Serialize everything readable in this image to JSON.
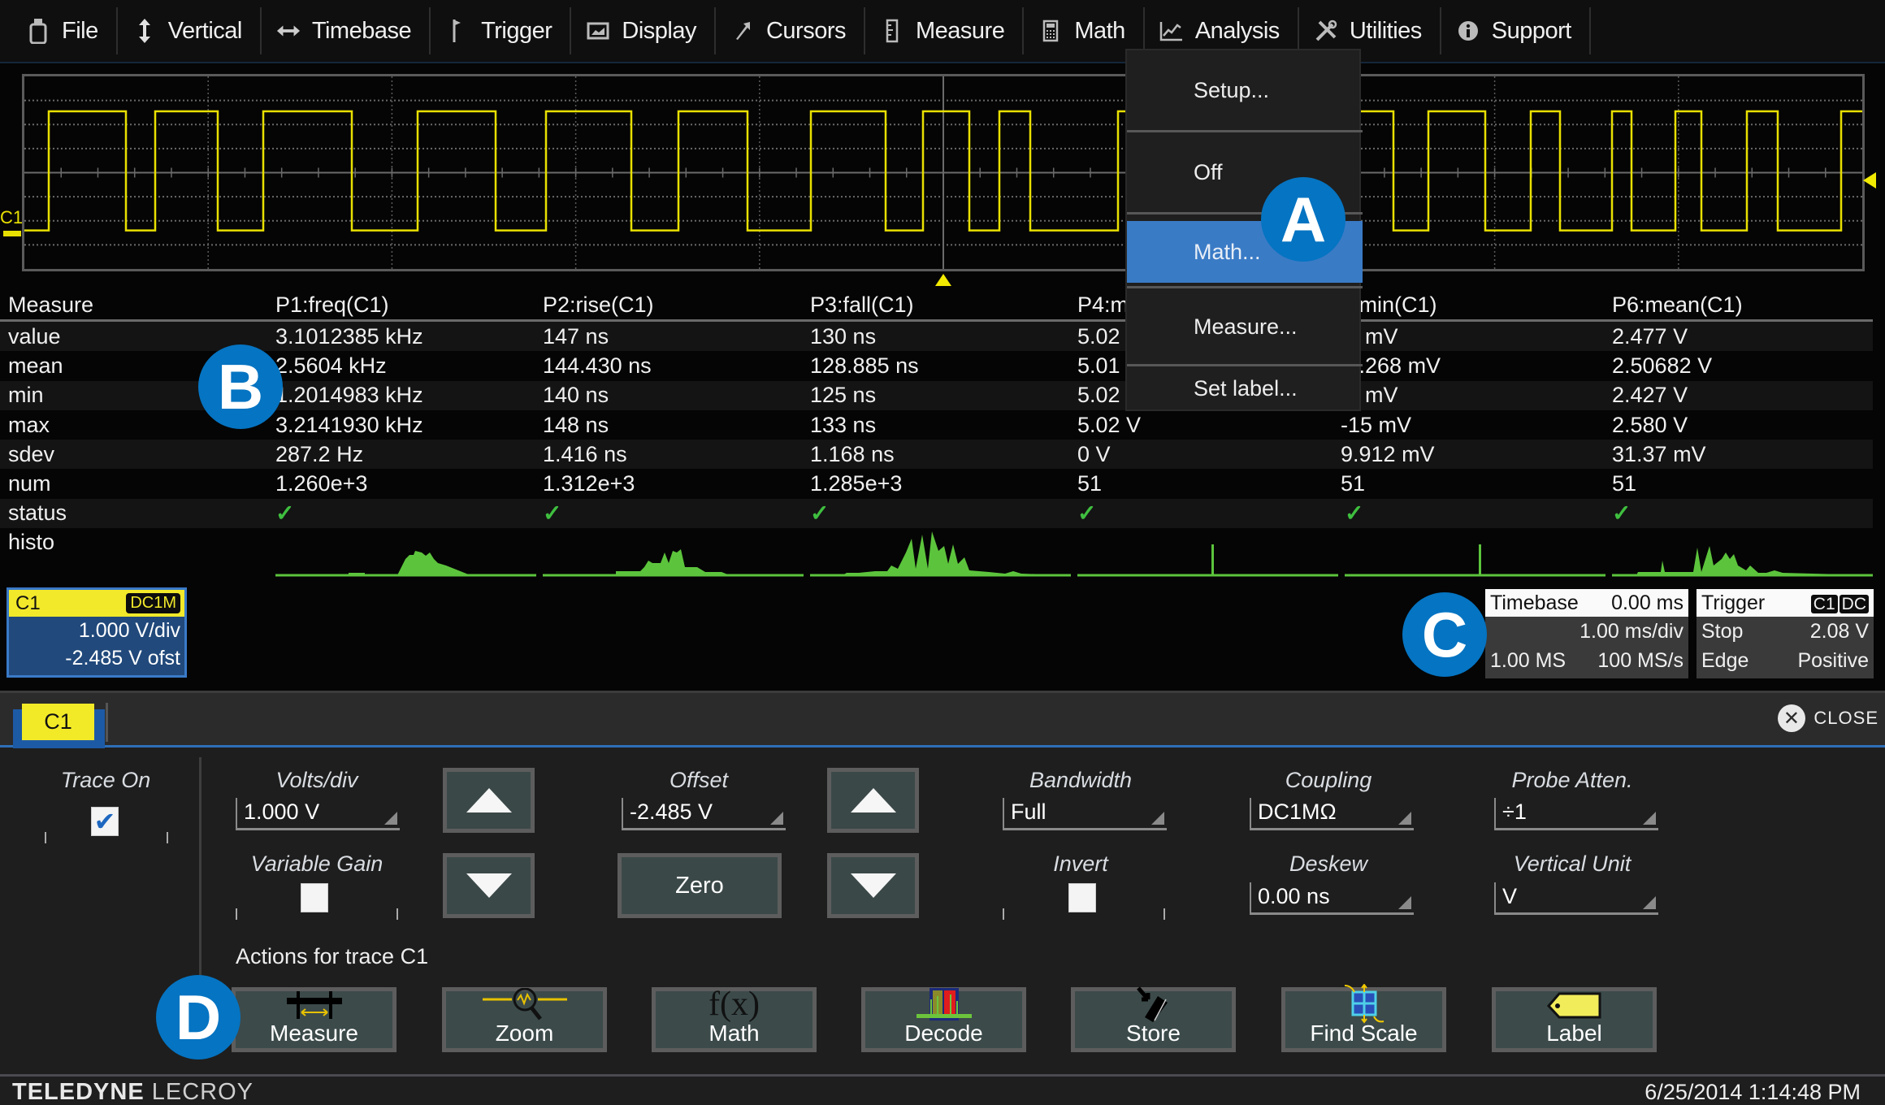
{
  "menubar": {
    "items": [
      {
        "label": "File",
        "icon": "file-icon"
      },
      {
        "label": "Vertical",
        "icon": "vertical-arrows-icon"
      },
      {
        "label": "Timebase",
        "icon": "horizontal-arrows-icon"
      },
      {
        "label": "Trigger",
        "icon": "trigger-flag-icon"
      },
      {
        "label": "Display",
        "icon": "display-icon"
      },
      {
        "label": "Cursors",
        "icon": "cursor-arrow-icon"
      },
      {
        "label": "Measure",
        "icon": "measure-ruler-icon"
      },
      {
        "label": "Math",
        "icon": "calculator-icon"
      },
      {
        "label": "Analysis",
        "icon": "chart-icon"
      },
      {
        "label": "Utilities",
        "icon": "tools-icon"
      },
      {
        "label": "Support",
        "icon": "info-icon"
      }
    ]
  },
  "dropdown": {
    "items": [
      {
        "label": "Setup...",
        "selected": false
      },
      {
        "label": "Off",
        "selected": false
      },
      {
        "label": "Math...",
        "selected": true
      },
      {
        "label": "Measure...",
        "selected": false
      },
      {
        "label": "Set label...",
        "selected": false
      }
    ]
  },
  "waveform": {
    "channel_label": "C1",
    "trace_color": "#e8e000"
  },
  "measurements": {
    "header": [
      "Measure",
      "P1:freq(C1)",
      "P2:rise(C1)",
      "P3:fall(C1)",
      "P4:m",
      "5:min(C1)",
      "P6:mean(C1)"
    ],
    "rows": [
      {
        "label": "value",
        "cells": [
          "3.1012385 kHz",
          "147 ns",
          "130 ns",
          "5.02",
          ".5 mV",
          "2.477 V"
        ]
      },
      {
        "label": "mean",
        "cells": [
          "2.5604 kHz",
          "144.430 ns",
          "128.885 ns",
          "5.01",
          ".8.268 mV",
          "2.50682 V"
        ]
      },
      {
        "label": "min",
        "cells": [
          "1.2014983 kHz",
          "140 ns",
          "125 ns",
          "5.02",
          ".8 mV",
          "2.427 V"
        ]
      },
      {
        "label": "max",
        "cells": [
          "3.2141930 kHz",
          "148 ns",
          "133 ns",
          "5.02 V",
          "-15 mV",
          "2.580 V"
        ]
      },
      {
        "label": "sdev",
        "cells": [
          "287.2 Hz",
          "1.416 ns",
          "1.168 ns",
          "0 V",
          "9.912 mV",
          "31.37 mV"
        ]
      },
      {
        "label": "num",
        "cells": [
          "1.260e+3",
          "1.312e+3",
          "1.285e+3",
          "51",
          "51",
          "51"
        ]
      }
    ],
    "status_label": "status",
    "status": [
      "ok",
      "ok",
      "ok",
      "ok",
      "ok",
      "ok"
    ],
    "status_glyph": "✓",
    "histo_label": "histo",
    "histo_color": "#5cc43c"
  },
  "channel_descriptor": {
    "name": "C1",
    "coupling": "DC1M",
    "volts_div": "1.000 V/div",
    "offset": "-2.485 V ofst",
    "header_color": "#f1e92a"
  },
  "timebase": {
    "title": "Timebase",
    "delay": "0.00 ms",
    "time_div": "1.00 ms/div",
    "samples": "1.00 MS",
    "sample_rate": "100 MS/s"
  },
  "trigger": {
    "title": "Trigger",
    "source_tag": "C1",
    "coupling_tag": "DC",
    "mode": "Stop",
    "level": "2.08 V",
    "type": "Edge",
    "slope": "Positive"
  },
  "dialog": {
    "tab": "C1",
    "close_label": "CLOSE",
    "trace_on": {
      "label": "Trace On",
      "checked": true
    },
    "volts_div": {
      "label": "Volts/div",
      "value": "1.000 V"
    },
    "variable_gain": {
      "label": "Variable Gain",
      "checked": false
    },
    "offset": {
      "label": "Offset",
      "value": "-2.485 V"
    },
    "zero_label": "Zero",
    "bandwidth": {
      "label": "Bandwidth",
      "value": "Full"
    },
    "coupling": {
      "label": "Coupling",
      "value": "DC1MΩ"
    },
    "probe_atten": {
      "label": "Probe Atten.",
      "value": "÷1"
    },
    "invert": {
      "label": "Invert",
      "checked": false
    },
    "deskew": {
      "label": "Deskew",
      "value": "0.00 ns"
    },
    "vertical_unit": {
      "label": "Vertical Unit",
      "value": "V"
    },
    "actions_label": "Actions for trace C1",
    "actions": [
      {
        "label": "Measure",
        "icon": "measure-calipers-icon"
      },
      {
        "label": "Zoom",
        "icon": "zoom-magnifier-icon"
      },
      {
        "label": "Math",
        "icon": "fx-icon"
      },
      {
        "label": "Decode",
        "icon": "decode-icon"
      },
      {
        "label": "Store",
        "icon": "store-memory-icon"
      },
      {
        "label": "Find Scale",
        "icon": "find-scale-icon"
      },
      {
        "label": "Label",
        "icon": "label-tag-icon"
      }
    ]
  },
  "footer": {
    "brand_bold": "TELEDYNE",
    "brand_light": "LECROY",
    "datetime": "6/25/2014 1:14:48 PM"
  },
  "callouts": {
    "a": "A",
    "b": "B",
    "c": "C",
    "d": "D"
  },
  "colors": {
    "accent_blue": "#3a7bc6",
    "callout_blue": "#0574c2",
    "channel_yellow": "#f1e92a",
    "status_green": "#3fbf3f"
  }
}
